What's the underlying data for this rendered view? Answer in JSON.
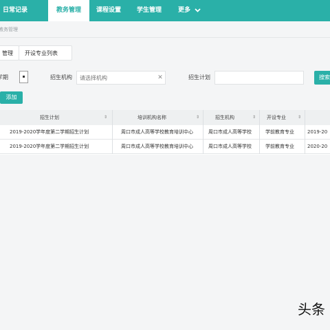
{
  "nav": {
    "items": [
      {
        "label": "日常记录"
      },
      {
        "label": "教务管理"
      },
      {
        "label": "课程设置"
      },
      {
        "label": "学生管理"
      },
      {
        "label": "更多"
      }
    ]
  },
  "breadcrumb": "教务管理",
  "subtabs": [
    "管理",
    "开设专业列表"
  ],
  "filters": {
    "type_label": "学期",
    "org_label": "招生机构",
    "org_placeholder": "请选择机构",
    "plan_label": "招生计划",
    "plan_value": "",
    "search_label": "搜索"
  },
  "add_button": "添加",
  "table": {
    "columns": [
      "招生计划",
      "培训机构名称",
      "招生机构",
      "开设专业",
      ""
    ],
    "rows": [
      [
        "2019-2020学年度第二学期招生计划",
        "周口市成人高等学校教育培训中心",
        "周口市成人高等学校",
        "学前教育专业",
        "2019-20"
      ],
      [
        "2019-2020学年度第二学期招生计划",
        "周口市成人高等学校教育培训中心",
        "周口市成人高等学校",
        "学前教育专业",
        "2020-20"
      ]
    ]
  },
  "watermark": "头条",
  "colors": {
    "accent": "#2ab0a8",
    "header_bg": "#eef0f1"
  }
}
